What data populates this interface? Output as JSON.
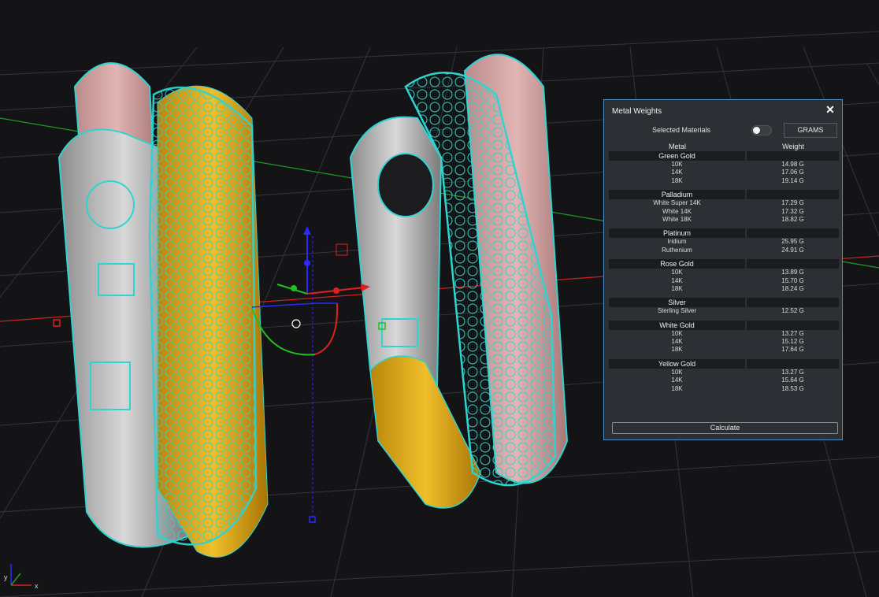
{
  "panel": {
    "title": "Metal Weights",
    "close_label": "✕",
    "selected_materials_label": "Selected Materials",
    "units_button": "GRAMS",
    "col_metal": "Metal",
    "col_weight": "Weight",
    "calculate_button": "Calculate",
    "groups": [
      {
        "name": "Green Gold",
        "rows": [
          {
            "metal": "10K",
            "weight": "14.98 G"
          },
          {
            "metal": "14K",
            "weight": "17.06 G"
          },
          {
            "metal": "18K",
            "weight": "19.14 G"
          }
        ]
      },
      {
        "name": "Palladium",
        "rows": [
          {
            "metal": "White Super 14K",
            "weight": "17.29 G"
          },
          {
            "metal": "White 14K",
            "weight": "17.32 G"
          },
          {
            "metal": "White 18K",
            "weight": "18.82 G"
          }
        ]
      },
      {
        "name": "Platinum",
        "rows": [
          {
            "metal": "Iridium",
            "weight": "25.95 G"
          },
          {
            "metal": "Ruthenium",
            "weight": "24.91 G"
          }
        ]
      },
      {
        "name": "Rose Gold",
        "rows": [
          {
            "metal": "10K",
            "weight": "13.89 G"
          },
          {
            "metal": "14K",
            "weight": "15.70 G"
          },
          {
            "metal": "18K",
            "weight": "18.24 G"
          }
        ]
      },
      {
        "name": "Silver",
        "rows": [
          {
            "metal": "Sterling Silver",
            "weight": "12.52 G"
          }
        ]
      },
      {
        "name": "White Gold",
        "rows": [
          {
            "metal": "10K",
            "weight": "13.27 G"
          },
          {
            "metal": "14K",
            "weight": "15.12 G"
          },
          {
            "metal": "18K",
            "weight": "17.64 G"
          }
        ]
      },
      {
        "name": "Yellow Gold",
        "rows": [
          {
            "metal": "10K",
            "weight": "13.27 G"
          },
          {
            "metal": "14K",
            "weight": "15.64 G"
          },
          {
            "metal": "18K",
            "weight": "18.53 G"
          }
        ]
      }
    ]
  },
  "viewport": {
    "axis_x_label": "x",
    "axis_y_label": "y",
    "colors": {
      "wire": "#2fd3cf",
      "rose": "#d7a5a5",
      "gold": "#e2ad1e",
      "silver": "#c8c8c8",
      "grid": "#3a3a3e",
      "axis_x": "#e02020",
      "axis_y": "#20a020",
      "axis_z": "#2030e0"
    }
  }
}
